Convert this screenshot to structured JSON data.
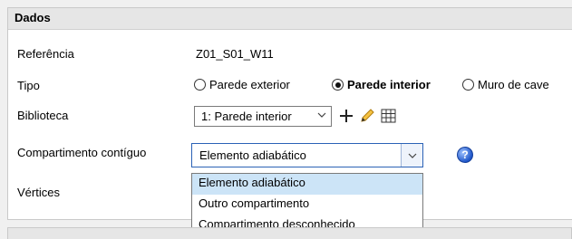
{
  "panel": {
    "title": "Dados"
  },
  "fields": {
    "referencia": {
      "label": "Referência",
      "value": "Z01_S01_W11"
    },
    "tipo": {
      "label": "Tipo",
      "options": [
        "Parede exterior",
        "Parede interior",
        "Muro de cave"
      ],
      "selected": "Parede interior"
    },
    "biblioteca": {
      "label": "Biblioteca",
      "value": "1: Parede interior"
    },
    "compartimento": {
      "label": "Compartimento contíguo",
      "value": "Elemento adiabático",
      "options": [
        "Elemento adiabático",
        "Outro compartimento",
        "Compartimento desconhecido"
      ]
    },
    "vertices": {
      "label": "Vértices"
    }
  },
  "icons": {
    "add": "plus-icon",
    "edit": "pencil-icon",
    "table": "table-grid-icon",
    "help": "help-icon",
    "dropdown": "chevron-down-icon"
  },
  "colors": {
    "accent": "#2b62b6",
    "selection": "#cce4f7",
    "pencil": "#e6a817"
  }
}
